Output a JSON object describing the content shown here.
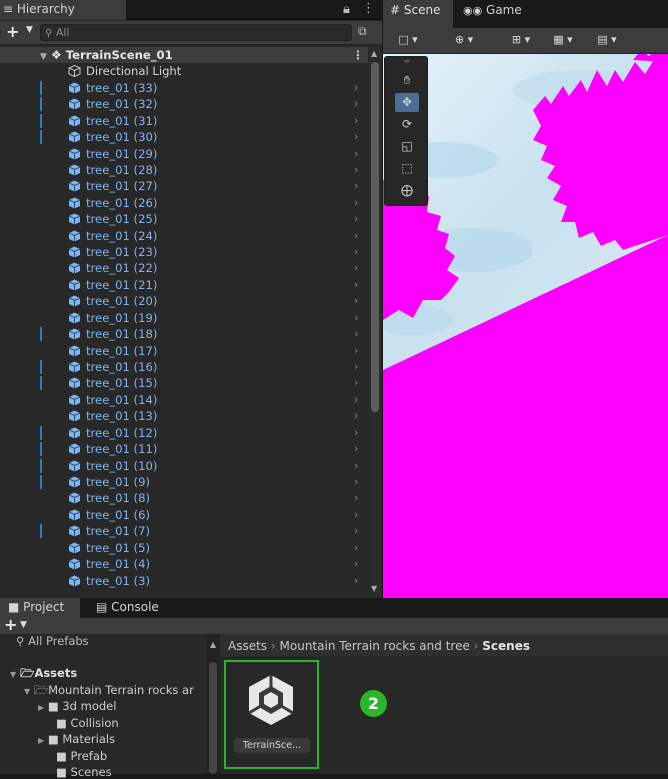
{
  "hierarchy": {
    "tab_label": "≡ Hierarchy",
    "search_placeholder": "All",
    "scene_name": "TerrainScene_01",
    "items": [
      {
        "label": "Directional Light",
        "indicator": false,
        "type": "light"
      },
      {
        "label": "tree_01 (33)",
        "indicator": true,
        "type": "prefab"
      },
      {
        "label": "tree_01 (32)",
        "indicator": true,
        "type": "prefab"
      },
      {
        "label": "tree_01 (31)",
        "indicator": true,
        "type": "prefab"
      },
      {
        "label": "tree_01 (30)",
        "indicator": true,
        "type": "prefab"
      },
      {
        "label": "tree_01 (29)",
        "indicator": false,
        "type": "prefab"
      },
      {
        "label": "tree_01 (28)",
        "indicator": false,
        "type": "prefab"
      },
      {
        "label": "tree_01 (27)",
        "indicator": false,
        "type": "prefab"
      },
      {
        "label": "tree_01 (26)",
        "indicator": false,
        "type": "prefab"
      },
      {
        "label": "tree_01 (25)",
        "indicator": false,
        "type": "prefab"
      },
      {
        "label": "tree_01 (24)",
        "indicator": false,
        "type": "prefab"
      },
      {
        "label": "tree_01 (23)",
        "indicator": false,
        "type": "prefab"
      },
      {
        "label": "tree_01 (22)",
        "indicator": false,
        "type": "prefab"
      },
      {
        "label": "tree_01 (21)",
        "indicator": false,
        "type": "prefab"
      },
      {
        "label": "tree_01 (20)",
        "indicator": false,
        "type": "prefab"
      },
      {
        "label": "tree_01 (19)",
        "indicator": false,
        "type": "prefab"
      },
      {
        "label": "tree_01 (18)",
        "indicator": true,
        "type": "prefab"
      },
      {
        "label": "tree_01 (17)",
        "indicator": false,
        "type": "prefab"
      },
      {
        "label": "tree_01 (16)",
        "indicator": true,
        "type": "prefab"
      },
      {
        "label": "tree_01 (15)",
        "indicator": true,
        "type": "prefab"
      },
      {
        "label": "tree_01 (14)",
        "indicator": false,
        "type": "prefab"
      },
      {
        "label": "tree_01 (13)",
        "indicator": false,
        "type": "prefab"
      },
      {
        "label": "tree_01 (12)",
        "indicator": true,
        "type": "prefab"
      },
      {
        "label": "tree_01 (11)",
        "indicator": true,
        "type": "prefab"
      },
      {
        "label": "tree_01 (10)",
        "indicator": true,
        "type": "prefab"
      },
      {
        "label": "tree_01 (9)",
        "indicator": true,
        "type": "prefab"
      },
      {
        "label": "tree_01 (8)",
        "indicator": false,
        "type": "prefab"
      },
      {
        "label": "tree_01 (6)",
        "indicator": false,
        "type": "prefab"
      },
      {
        "label": "tree_01 (7)",
        "indicator": true,
        "type": "prefab"
      },
      {
        "label": "tree_01 (5)",
        "indicator": false,
        "type": "prefab"
      },
      {
        "label": "tree_01 (4)",
        "indicator": false,
        "type": "prefab"
      },
      {
        "label": "tree_01 (3)",
        "indicator": false,
        "type": "prefab"
      }
    ]
  },
  "scene_view": {
    "tab_scene": "Scene",
    "tab_game": "Game",
    "icons": {
      "scene_tab": "hash-icon",
      "game_tab": "gamepad-icon"
    },
    "colors": {
      "missing_material": "#ff00ff",
      "sky": "#cfe6f2"
    }
  },
  "project": {
    "tab_project": "Project",
    "tab_console": "Console",
    "all_prefabs": "All Prefabs",
    "tree": [
      {
        "label": "Assets",
        "bold": true
      },
      {
        "label": "Mountain Terrain rocks ar",
        "bold": false
      },
      {
        "label": "3d model",
        "bold": false
      },
      {
        "label": "Collision",
        "bold": false
      },
      {
        "label": "Materials",
        "bold": false
      },
      {
        "label": "Prefab",
        "bold": false
      },
      {
        "label": "Scenes",
        "bold": false
      }
    ],
    "breadcrumb": [
      "Assets",
      "Mountain Terrain rocks and tree",
      "Scenes"
    ],
    "asset_label": "TerrainSce...",
    "badge": "2",
    "colors": {
      "highlight": "#2bb52b"
    }
  }
}
